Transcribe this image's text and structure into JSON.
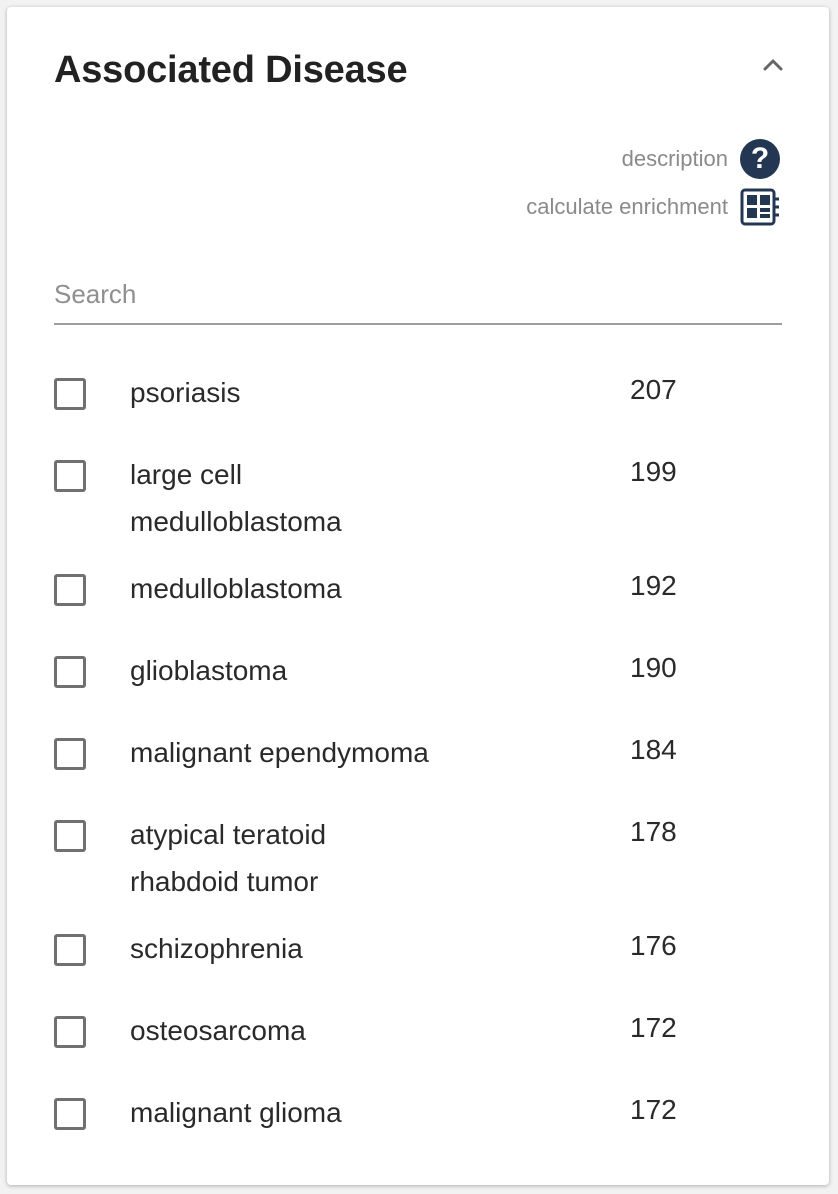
{
  "panel": {
    "title": "Associated Disease",
    "collapse_icon": "chevron-up-icon"
  },
  "actions": {
    "description_label": "description",
    "description_icon": "help-icon",
    "enrichment_label": "calculate enrichment",
    "enrichment_icon": "calculator-icon"
  },
  "search": {
    "placeholder": "Search",
    "value": ""
  },
  "colors": {
    "accent_navy": "#243752",
    "text": "#2a2a2a",
    "muted": "#8a8a8a"
  },
  "items": [
    {
      "label": "psoriasis",
      "count": "207",
      "checked": false
    },
    {
      "label": "large cell medulloblastoma",
      "count": "199",
      "checked": false
    },
    {
      "label": "medulloblastoma",
      "count": "192",
      "checked": false
    },
    {
      "label": "glioblastoma",
      "count": "190",
      "checked": false
    },
    {
      "label": "malignant ependymoma",
      "count": "184",
      "checked": false
    },
    {
      "label": "atypical teratoid rhabdoid tumor",
      "count": "178",
      "checked": false
    },
    {
      "label": "schizophrenia",
      "count": "176",
      "checked": false
    },
    {
      "label": "osteosarcoma",
      "count": "172",
      "checked": false
    },
    {
      "label": "malignant glioma",
      "count": "172",
      "checked": false
    }
  ]
}
